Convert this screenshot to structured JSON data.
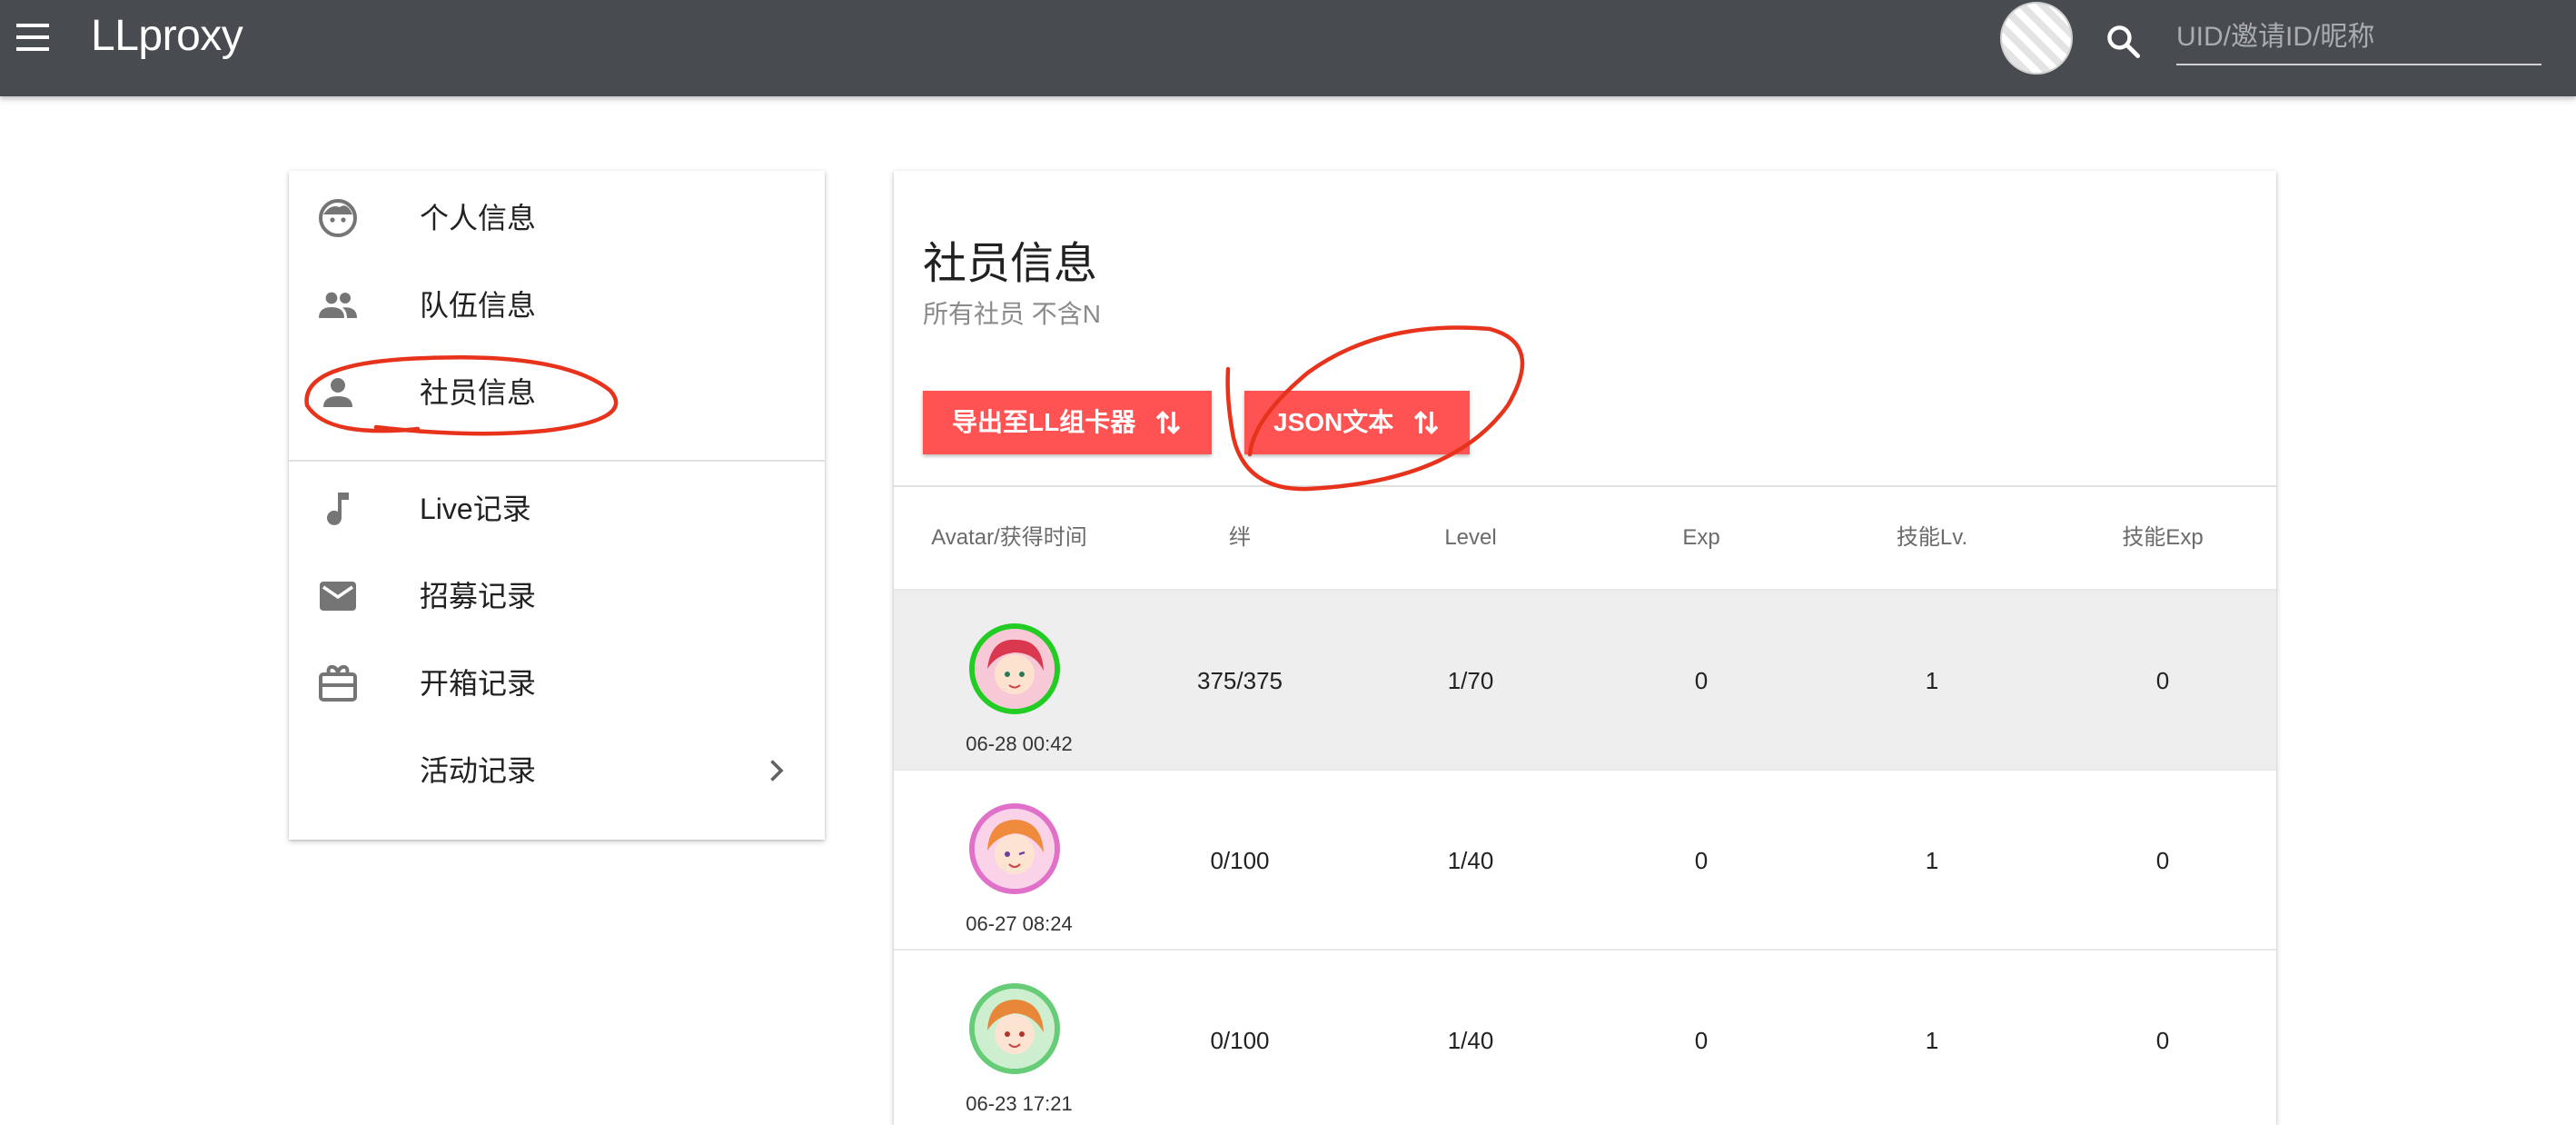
{
  "app": {
    "title": "LLproxy"
  },
  "search": {
    "placeholder": "UID/邀请ID/昵称"
  },
  "sidebar": {
    "items": [
      {
        "label": "个人信息",
        "icon": "face-icon"
      },
      {
        "label": "队伍信息",
        "icon": "group-icon"
      },
      {
        "label": "社员信息",
        "icon": "person-icon"
      },
      {
        "label": "Live记录",
        "icon": "music-note-icon"
      },
      {
        "label": "招募记录",
        "icon": "mail-icon"
      },
      {
        "label": "开箱记录",
        "icon": "gift-box-icon"
      },
      {
        "label": "活动记录",
        "icon": "chevron-right-icon"
      }
    ]
  },
  "main": {
    "title": "社员信息",
    "subtitle": "所有社员 不含N",
    "buttons": {
      "export_label": "导出至LL组卡器",
      "json_label": "JSON文本",
      "icon": "swap-vertical-icon"
    },
    "table": {
      "headers": [
        "Avatar/获得时间",
        "绊",
        "Level",
        "Exp",
        "技能Lv.",
        "技能Exp"
      ],
      "rows": [
        {
          "time": "06-28 00:42",
          "bond": "375/375",
          "level": "1/70",
          "exp": "0",
          "skill_lv": "1",
          "skill_exp": "0",
          "frame_color": "#22cc22"
        },
        {
          "time": "06-27 08:24",
          "bond": "0/100",
          "level": "1/40",
          "exp": "0",
          "skill_lv": "1",
          "skill_exp": "0",
          "frame_color": "#e070c8"
        },
        {
          "time": "06-23 17:21",
          "bond": "0/100",
          "level": "1/40",
          "exp": "0",
          "skill_lv": "1",
          "skill_exp": "0",
          "frame_color": "#66cc77"
        }
      ]
    }
  },
  "colors": {
    "topbar": "#484b50",
    "accent_button": "#ff5252",
    "annotation": "#e8331c",
    "selected_row": "#eeeeee"
  }
}
